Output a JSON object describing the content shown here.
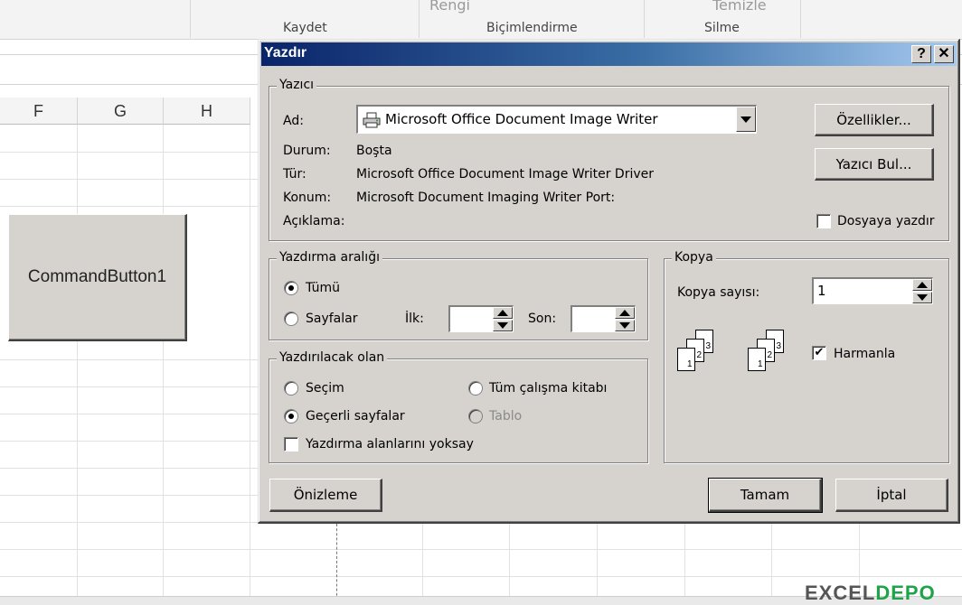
{
  "ribbon": {
    "top_texts": [
      "Rengi",
      "Temizle"
    ],
    "groups": [
      "Kaydet",
      "Biçimlendirme",
      "Silme"
    ]
  },
  "sheet": {
    "columns": [
      "F",
      "G",
      "H"
    ],
    "command_button_label": "CommandButton1"
  },
  "watermark": {
    "part1": "EXCEL",
    "part2": "DEPO"
  },
  "dialog": {
    "title": "Yazdır",
    "help_label": "?",
    "close_label": "✕",
    "printer": {
      "legend": "Yazıcı",
      "name_label": "Ad:",
      "selected_printer": "Microsoft Office Document Image Writer",
      "status_label": "Durum:",
      "status_value": "Boşta",
      "type_label": "Tür:",
      "type_value": "Microsoft Office Document Image Writer Driver",
      "location_label": "Konum:",
      "location_value": "Microsoft Document Imaging Writer Port:",
      "comment_label": "Açıklama:",
      "properties_button": "Özellikler...",
      "find_printer_button": "Yazıcı Bul...",
      "print_to_file_label": "Dosyaya yazdır",
      "print_to_file_checked": false
    },
    "print_range": {
      "legend": "Yazdırma aralığı",
      "all_label": "Tümü",
      "pages_label": "Sayfalar",
      "from_label": "İlk:",
      "to_label": "Son:",
      "from_value": "",
      "to_value": "",
      "selected": "all"
    },
    "print_what": {
      "legend": "Yazdırılacak olan",
      "selection_label": "Seçim",
      "entire_workbook_label": "Tüm çalışma kitabı",
      "active_sheets_label": "Geçerli sayfalar",
      "table_label": "Tablo",
      "ignore_print_areas_label": "Yazdırma alanlarını yoksay",
      "selected": "active_sheets",
      "ignore_print_areas_checked": false
    },
    "copies": {
      "legend": "Kopya",
      "count_label": "Kopya sayısı:",
      "count_value": "1",
      "collate_label": "Harmanla",
      "collate_checked": true,
      "page_numbers": [
        "1",
        "2",
        "3"
      ]
    },
    "preview_button": "Önizleme",
    "ok_button": "Tamam",
    "cancel_button": "İptal"
  }
}
